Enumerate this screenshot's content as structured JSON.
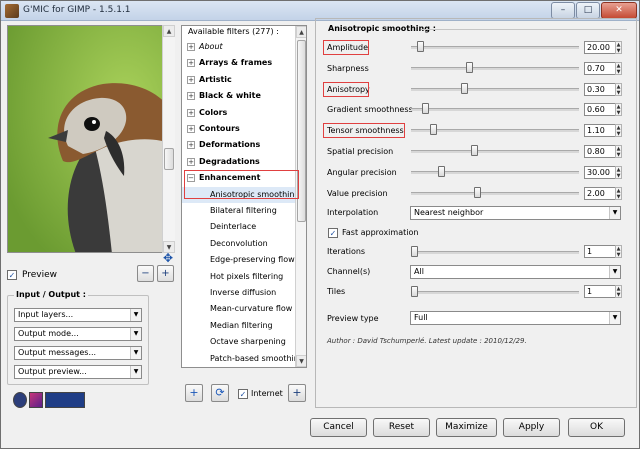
{
  "window": {
    "title": "G'MIC for GIMP - 1.5.1.1",
    "minimize": "–",
    "maximize": "□",
    "close": "✕"
  },
  "preview": {
    "label": "Preview",
    "checked": "✓",
    "zoom_out": "−",
    "zoom_in": "+",
    "move": "✥"
  },
  "io": {
    "title": "Input / Output :",
    "fields": [
      "Input layers...",
      "Output mode...",
      "Output messages...",
      "Output preview..."
    ]
  },
  "logos": [
    "G'MIC",
    "GREYC",
    "ENSICAEN"
  ],
  "filters": {
    "header": "Available filters (277) :",
    "items": [
      {
        "label": "About",
        "style": "italic",
        "exp": "+"
      },
      {
        "label": "Arrays & frames",
        "style": "bold",
        "exp": "+"
      },
      {
        "label": "Artistic",
        "style": "bold",
        "exp": "+"
      },
      {
        "label": "Black & white",
        "style": "bold",
        "exp": "+"
      },
      {
        "label": "Colors",
        "style": "bold",
        "exp": "+"
      },
      {
        "label": "Contours",
        "style": "bold",
        "exp": "+"
      },
      {
        "label": "Deformations",
        "style": "bold",
        "exp": "+"
      },
      {
        "label": "Degradations",
        "style": "bold",
        "exp": "+"
      },
      {
        "label": "Enhancement",
        "style": "bold",
        "exp": "−"
      },
      {
        "label": "Anisotropic smoothing",
        "style": "sub"
      },
      {
        "label": "Bilateral filtering",
        "style": "sub"
      },
      {
        "label": "Deinterlace",
        "style": "sub"
      },
      {
        "label": "Deconvolution",
        "style": "sub"
      },
      {
        "label": "Edge-preserving flow",
        "style": "sub"
      },
      {
        "label": "Hot pixels filtering",
        "style": "sub"
      },
      {
        "label": "Inverse diffusion",
        "style": "sub"
      },
      {
        "label": "Mean-curvature flow",
        "style": "sub"
      },
      {
        "label": "Median filtering",
        "style": "sub"
      },
      {
        "label": "Octave sharpening",
        "style": "sub"
      },
      {
        "label": "Patch-based smoothing",
        "style": "sub"
      }
    ],
    "add": "+",
    "refresh": "⟳",
    "internet_label": "Internet",
    "internet_checked": "✓",
    "zoom": "+"
  },
  "params": {
    "title": "Anisotropic smoothing :",
    "sliders": [
      {
        "label": "Amplitude",
        "value": "20.00"
      },
      {
        "label": "Sharpness",
        "value": "0.70"
      },
      {
        "label": "Anisotropy",
        "value": "0.30"
      },
      {
        "label": "Gradient smoothness",
        "value": "0.60"
      },
      {
        "label": "Tensor smoothness",
        "value": "1.10"
      },
      {
        "label": "Spatial precision",
        "value": "0.80"
      },
      {
        "label": "Angular precision",
        "value": "30.00"
      },
      {
        "label": "Value precision",
        "value": "2.00"
      }
    ],
    "slider_fraction": [
      0.04,
      0.34,
      0.31,
      0.07,
      0.12,
      0.37,
      0.17,
      0.39
    ],
    "interpolation_label": "Interpolation",
    "interpolation_value": "Nearest neighbor",
    "fast_approx_label": "Fast approximation",
    "fast_approx_checked": "✓",
    "iterations_label": "Iterations",
    "iterations_value": "1",
    "channels_label": "Channel(s)",
    "channels_value": "All",
    "tiles_label": "Tiles",
    "tiles_value": "1",
    "preview_type_label": "Preview type",
    "preview_type_value": "Full",
    "author": "Author : David Tschumperlé.      Latest update : 2010/12/29."
  },
  "buttons": {
    "cancel": "Cancel",
    "reset": "Reset",
    "maximize": "Maximize",
    "apply": "Apply",
    "ok": "OK"
  },
  "colors": {
    "highlight_border": "#e04040",
    "titlebar": "#c3d3e8",
    "selection": "#dde9f7"
  }
}
